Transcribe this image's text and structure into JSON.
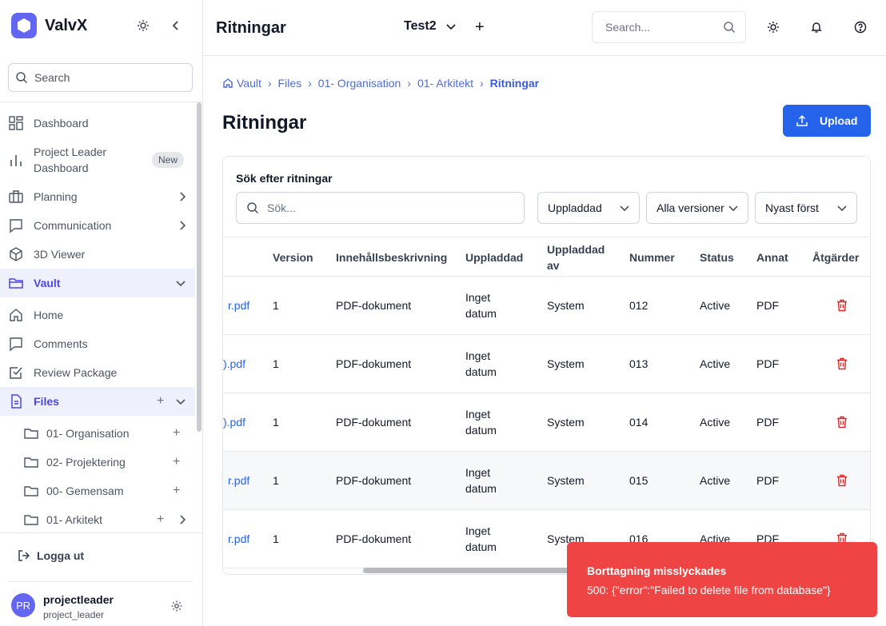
{
  "app": {
    "name": "ValvX"
  },
  "sidebar": {
    "search_label": "Search",
    "items": [
      {
        "label": "Dashboard",
        "icon": "dashboard-icon"
      },
      {
        "label": "Project Leader Dashboard",
        "label_line1": "Project Leader",
        "label_line2": "Dashboard",
        "badge": "New",
        "icon": "bar-chart-icon"
      },
      {
        "label": "Planning",
        "icon": "briefcase-icon"
      },
      {
        "label": "Communication",
        "icon": "chat-icon"
      },
      {
        "label": "3D Viewer",
        "icon": "cube-icon"
      },
      {
        "label": "Vault",
        "icon": "folder-open-icon",
        "active": true
      },
      {
        "label": "Home",
        "icon": "home-icon"
      },
      {
        "label": "Comments",
        "icon": "comment-icon"
      },
      {
        "label": "Review Package",
        "icon": "checkbox-icon"
      },
      {
        "label": "Files",
        "icon": "file-icon",
        "active": true
      }
    ],
    "folders": [
      {
        "label": "01- Organisation"
      },
      {
        "label": "02- Projektering"
      },
      {
        "label": "00- Gemensam"
      },
      {
        "label": "01- Arkitekt"
      }
    ],
    "logout_label": "Logga ut",
    "user": {
      "initials": "PR",
      "name": "projectleader",
      "role": "project_leader"
    }
  },
  "topbar": {
    "page_title": "Ritningar",
    "project": "Test2",
    "search_placeholder": "Search..."
  },
  "breadcrumb": [
    "Vault",
    "Files",
    "01- Organisation",
    "01- Arkitekt",
    "Ritningar"
  ],
  "main": {
    "title": "Ritningar",
    "upload_label": "Upload",
    "search_label": "Sök efter ritningar",
    "search_placeholder": "Sök...",
    "filters": {
      "uploaded": "Uppladdad",
      "versions": "Alla versioner",
      "sort": "Nyast först"
    }
  },
  "table": {
    "columns": [
      "Version",
      "Innehållsbeskrivning",
      "Uppladdad",
      "Uppladdad av",
      "Nummer",
      "Status",
      "Annat",
      "Åtgärder"
    ],
    "col_uploaded_by_l1": "Uppladdad",
    "col_uploaded_by_l2": "av",
    "rows": [
      {
        "file": "r.pdf",
        "version": "1",
        "desc": "PDF-dokument",
        "up1": "Inget",
        "up2": "datum",
        "by": "System",
        "number": "012",
        "status": "Active",
        "other": "PDF"
      },
      {
        "file": ").pdf",
        "version": "1",
        "desc": "PDF-dokument",
        "up1": "Inget",
        "up2": "datum",
        "by": "System",
        "number": "013",
        "status": "Active",
        "other": "PDF"
      },
      {
        "file": ").pdf",
        "version": "1",
        "desc": "PDF-dokument",
        "up1": "Inget",
        "up2": "datum",
        "by": "System",
        "number": "014",
        "status": "Active",
        "other": "PDF"
      },
      {
        "file": "r.pdf",
        "version": "1",
        "desc": "PDF-dokument",
        "up1": "Inget",
        "up2": "datum",
        "by": "System",
        "number": "015",
        "status": "Active",
        "other": "PDF"
      },
      {
        "file": "r.pdf",
        "version": "1",
        "desc": "PDF-dokument",
        "up1": "Inget",
        "up2": "datum",
        "by": "System",
        "number": "016",
        "status": "Active",
        "other": "PDF"
      }
    ]
  },
  "toast": {
    "title": "Borttagning misslyckades",
    "message": "500: {\"error\":\"Failed to delete file from database\"}"
  },
  "colors": {
    "accent": "#4f46e5",
    "primary": "#2563eb",
    "error": "#ef4444",
    "delete": "#dc2626"
  }
}
